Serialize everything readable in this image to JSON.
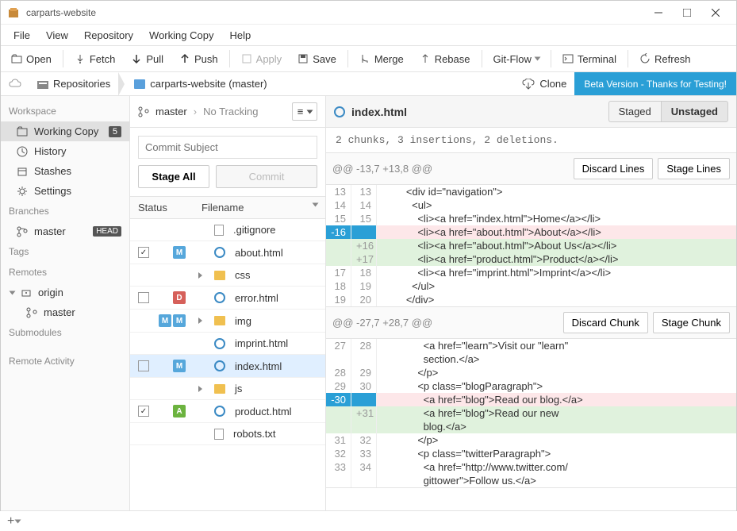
{
  "window": {
    "title": "carparts-website"
  },
  "menu": {
    "file": "File",
    "view": "View",
    "repository": "Repository",
    "workingcopy": "Working Copy",
    "help": "Help"
  },
  "toolbar": {
    "open": "Open",
    "fetch": "Fetch",
    "pull": "Pull",
    "push": "Push",
    "apply": "Apply",
    "save": "Save",
    "merge": "Merge",
    "rebase": "Rebase",
    "gitflow": "Git-Flow",
    "terminal": "Terminal",
    "refresh": "Refresh"
  },
  "crumbs": {
    "repositories": "Repositories",
    "reponame": "carparts-website (master)",
    "clone": "Clone",
    "beta": "Beta Version - Thanks for Testing!"
  },
  "sidebar": {
    "workspace": "Workspace",
    "workingcopy": "Working Copy",
    "workingcopy_badge": "5",
    "history": "History",
    "stashes": "Stashes",
    "settings": "Settings",
    "branches": "Branches",
    "master": "master",
    "head": "HEAD",
    "tags": "Tags",
    "remotes": "Remotes",
    "origin": "origin",
    "origin_master": "master",
    "submodules": "Submodules",
    "remote_activity": "Remote Activity"
  },
  "commit": {
    "branch": "master",
    "breadcrumb_sep": "›",
    "tracking": "No Tracking",
    "subject_placeholder": "Commit Subject",
    "stage_all": "Stage All",
    "commit": "Commit",
    "col_status": "Status",
    "col_filename": "Filename"
  },
  "files": [
    {
      "name": ".gitignore",
      "icon": "file",
      "check": null,
      "badges": [],
      "folder": false
    },
    {
      "name": "about.html",
      "icon": "ie",
      "check": true,
      "badges": [
        "M"
      ],
      "folder": false
    },
    {
      "name": "css",
      "icon": "folder",
      "check": null,
      "badges": [],
      "folder": true
    },
    {
      "name": "error.html",
      "icon": "ie",
      "check": false,
      "badges": [
        "D"
      ],
      "folder": false
    },
    {
      "name": "img",
      "icon": "folder",
      "check": null,
      "badges": [
        "M",
        "M"
      ],
      "folder": true
    },
    {
      "name": "imprint.html",
      "icon": "ie",
      "check": null,
      "badges": [],
      "folder": false
    },
    {
      "name": "index.html",
      "icon": "ie",
      "check": false,
      "badges": [
        "M"
      ],
      "folder": false,
      "selected": true
    },
    {
      "name": "js",
      "icon": "folder",
      "check": null,
      "badges": [],
      "folder": true
    },
    {
      "name": "product.html",
      "icon": "ie",
      "check": true,
      "badges": [
        "A"
      ],
      "folder": false
    },
    {
      "name": "robots.txt",
      "icon": "file",
      "check": null,
      "badges": [],
      "folder": false
    }
  ],
  "diff": {
    "filename": "index.html",
    "tab_staged": "Staged",
    "tab_unstaged": "Unstaged",
    "summary": "2 chunks, 3 insertions, 2 deletions.",
    "hunk1": {
      "header": "@@ -13,7 +13,8 @@",
      "discard": "Discard Lines",
      "stage": "Stage Lines",
      "lines": [
        {
          "a": "13",
          "b": "13",
          "t": "ctx",
          "code": "        <div id=\"navigation\">"
        },
        {
          "a": "14",
          "b": "14",
          "t": "ctx",
          "code": "          <ul>"
        },
        {
          "a": "15",
          "b": "15",
          "t": "ctx",
          "code": "            <li><a href=\"index.html\">Home</a></li>"
        },
        {
          "a": "-16",
          "b": "",
          "t": "del",
          "code": "            <li><a href=\"about.html\">About</a></li>"
        },
        {
          "a": "",
          "b": "+16",
          "t": "add",
          "code": "            <li><a href=\"about.html\">About Us</a></li>"
        },
        {
          "a": "",
          "b": "+17",
          "t": "add",
          "code": "            <li><a href=\"product.html\">Product</a></li>"
        },
        {
          "a": "17",
          "b": "18",
          "t": "ctx",
          "code": "            <li><a href=\"imprint.html\">Imprint</a></li>"
        },
        {
          "a": "18",
          "b": "19",
          "t": "ctx",
          "code": "          </ul>"
        },
        {
          "a": "19",
          "b": "20",
          "t": "ctx",
          "code": "        </div>"
        }
      ]
    },
    "hunk2": {
      "header": "@@ -27,7 +28,7 @@",
      "discard": "Discard Chunk",
      "stage": "Stage Chunk",
      "lines": [
        {
          "a": "27",
          "b": "28",
          "t": "ctx",
          "code": "              <a href=\"learn\">Visit our \"learn\"\n              section.</a>"
        },
        {
          "a": "28",
          "b": "29",
          "t": "ctx",
          "code": "            </p>"
        },
        {
          "a": "29",
          "b": "30",
          "t": "ctx",
          "code": "            <p class=\"blogParagraph\">"
        },
        {
          "a": "-30",
          "b": "",
          "t": "del",
          "code": "              <a href=\"blog\">Read our blog.</a>"
        },
        {
          "a": "",
          "b": "+31",
          "t": "add",
          "code": "              <a href=\"blog\">Read our new\n              blog.</a>"
        },
        {
          "a": "31",
          "b": "32",
          "t": "ctx",
          "code": "            </p>"
        },
        {
          "a": "32",
          "b": "33",
          "t": "ctx",
          "code": "            <p class=\"twitterParagraph\">"
        },
        {
          "a": "33",
          "b": "34",
          "t": "ctx",
          "code": "              <a href=\"http://www.twitter.com/\n              gittower\">Follow us.</a>"
        }
      ]
    }
  }
}
